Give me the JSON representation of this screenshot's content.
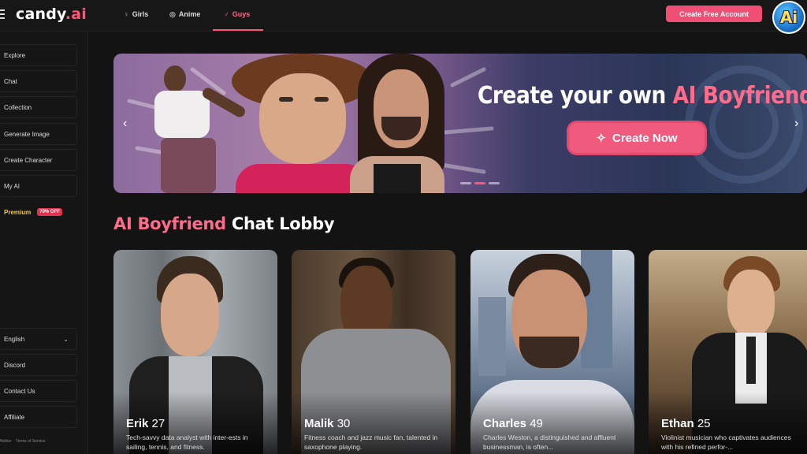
{
  "app": {
    "logo_text": "candy",
    "logo_suffix": ".ai",
    "accent": "#ff5577"
  },
  "nav": {
    "tabs": [
      {
        "label": "Girls",
        "icon": "female-icon"
      },
      {
        "label": "Anime",
        "icon": "anime-icon"
      },
      {
        "label": "Guys",
        "icon": "male-icon",
        "active": true
      }
    ],
    "create_account": "Create Free Account",
    "corner_badge": "Ai"
  },
  "sidebar": {
    "items": [
      {
        "label": "Explore"
      },
      {
        "label": "Chat"
      },
      {
        "label": "Collection"
      },
      {
        "label": "Generate Image"
      },
      {
        "label": "Create Character"
      },
      {
        "label": "My AI"
      }
    ],
    "premium": {
      "label": "Premium",
      "badge": "70% OFF"
    },
    "bottom_items": [
      {
        "label": "English"
      },
      {
        "label": "Discord"
      },
      {
        "label": "Contact Us"
      },
      {
        "label": "Affiliate"
      }
    ],
    "footer": {
      "notice": "Notice",
      "terms": "Terms of Service"
    }
  },
  "banner": {
    "title_part1": "Create your own ",
    "title_accent": "AI Boyfriend",
    "cta": "Create Now",
    "prev": "‹",
    "next": "›"
  },
  "lobby": {
    "title_accent": "AI Boyfriend",
    "title_rest": " Chat Lobby",
    "cards": [
      {
        "name": "Erik",
        "age": "27",
        "desc": "Tech-savvy data analyst with inter-ests in sailing, tennis, and fitness."
      },
      {
        "name": "Malik",
        "age": "30",
        "desc": "Fitness coach and jazz music fan, talented in saxophone playing."
      },
      {
        "name": "Charles",
        "age": "49",
        "desc": "Charles Weston, a distinguished and affluent businessman, is often..."
      },
      {
        "name": "Ethan",
        "age": "25",
        "desc": "Violinist musician who captivates audiences with his refined perfor-..."
      }
    ]
  }
}
